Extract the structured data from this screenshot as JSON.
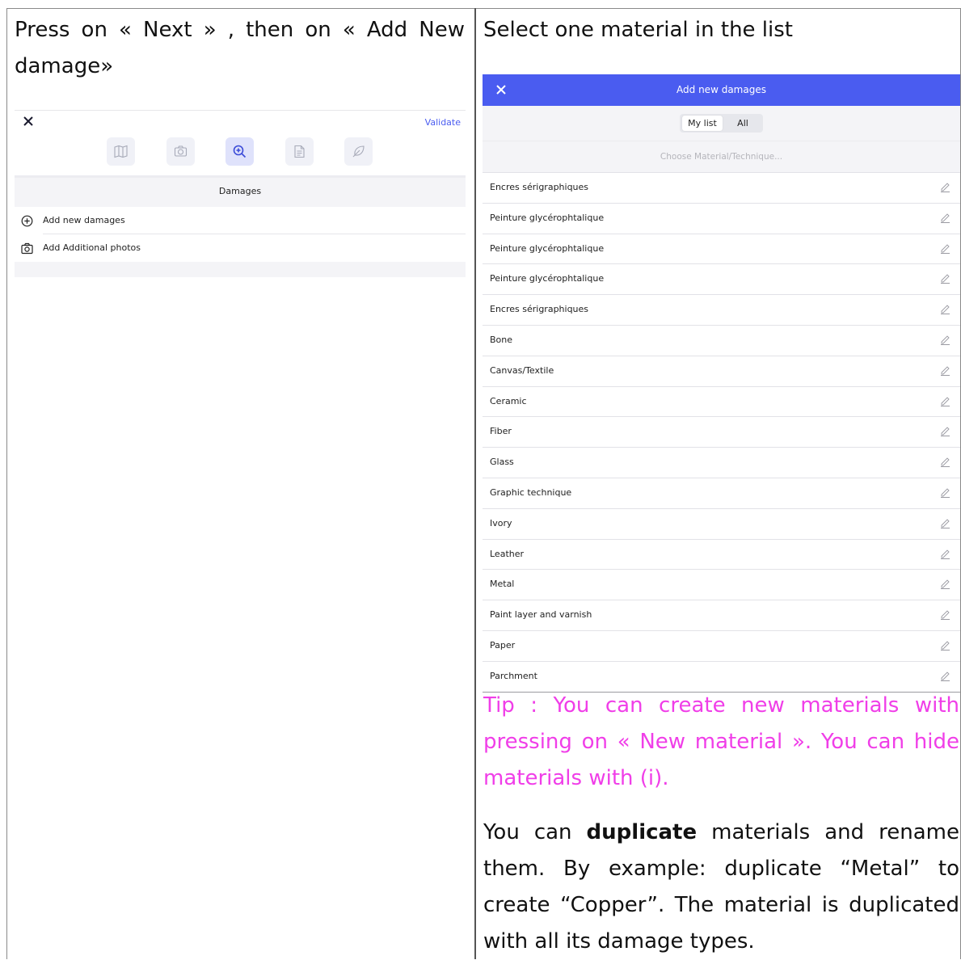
{
  "left_column": {
    "instruction": "Press on « Next » , then on « Add New damage»"
  },
  "left_app": {
    "close_icon": "close-icon",
    "validate_label": "Validate",
    "steps": [
      {
        "icon": "book-icon",
        "active": false
      },
      {
        "icon": "camera-icon",
        "active": false
      },
      {
        "icon": "zoom-in-icon",
        "active": true
      },
      {
        "icon": "document-icon",
        "active": false
      },
      {
        "icon": "feather-icon",
        "active": false
      }
    ],
    "section_title": "Damages",
    "actions": [
      {
        "icon": "add-circle-icon",
        "label": "Add new damages"
      },
      {
        "icon": "camera-icon",
        "label": "Add Additional photos"
      }
    ],
    "accent_color": "#4a5cf0"
  },
  "right_column": {
    "instruction": "Select one material in the list"
  },
  "right_app": {
    "header_title": "Add new damages",
    "header_color": "#4a5cf0",
    "segments": {
      "selected": "My list",
      "other": "All"
    },
    "search_placeholder": "Choose Material/Technique...",
    "materials": [
      "Encres sérigraphiques",
      "Peinture glycérophtalique",
      "Peinture glycérophtalique",
      "Peinture glycérophtalique",
      "Encres sérigraphiques",
      "Bone",
      "Canvas/Textile",
      "Ceramic",
      "Fiber",
      "Glass",
      "Graphic technique",
      "Ivory",
      "Leather",
      "Metal",
      "Paint layer and varnish",
      "Paper",
      "Parchment"
    ]
  },
  "tip": {
    "text": "Tip : You can create new materials with pressing on « New material ». You can hide materials with (i).",
    "color": "#f03ee8"
  },
  "note": {
    "before": "You can ",
    "bold": "duplicate",
    "after": " materials and rename them. By example: duplicate “Metal” to create “Copper”. The material is duplicated with all its damage types."
  }
}
